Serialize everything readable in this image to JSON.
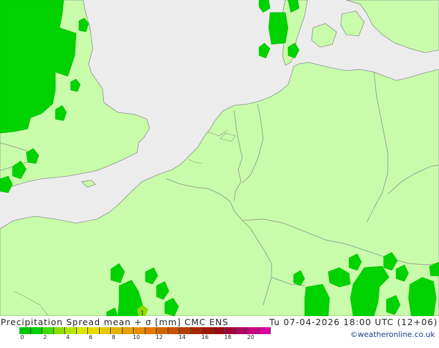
{
  "title": {
    "left": "Precipitation Spread mean + σ [mm] CMC ENS",
    "right": "Tu 07-04-2026 18:00 UTC (12+06)"
  },
  "credit": "©weatheronline.co.uk",
  "colors": {
    "sea": "#ececec",
    "land": "#c8fcaa",
    "border": "#8c8c8c",
    "precip_green": "#00d200"
  },
  "legend": {
    "colors": [
      "#00c800",
      "#00d200",
      "#3cdc00",
      "#8cdc00",
      "#b4e600",
      "#dce600",
      "#e6dc00",
      "#e6c800",
      "#e6b400",
      "#e6a000",
      "#e68c00",
      "#e67800",
      "#d26400",
      "#c85000",
      "#b43c00",
      "#aa2800",
      "#a01400",
      "#960a14",
      "#a0003c",
      "#b40064",
      "#c80082",
      "#dc00a0"
    ],
    "ticks": [
      {
        "label": "0",
        "index": 0
      },
      {
        "label": "2",
        "index": 2
      },
      {
        "label": "4",
        "index": 4
      },
      {
        "label": "6",
        "index": 6
      },
      {
        "label": "8",
        "index": 8
      },
      {
        "label": "10",
        "index": 10
      },
      {
        "label": "12",
        "index": 12
      },
      {
        "label": "14",
        "index": 14
      },
      {
        "label": "16",
        "index": 16
      },
      {
        "label": "18",
        "index": 18
      },
      {
        "label": "20",
        "index": 20
      }
    ]
  },
  "map_labels": {
    "precip_value": "1"
  }
}
